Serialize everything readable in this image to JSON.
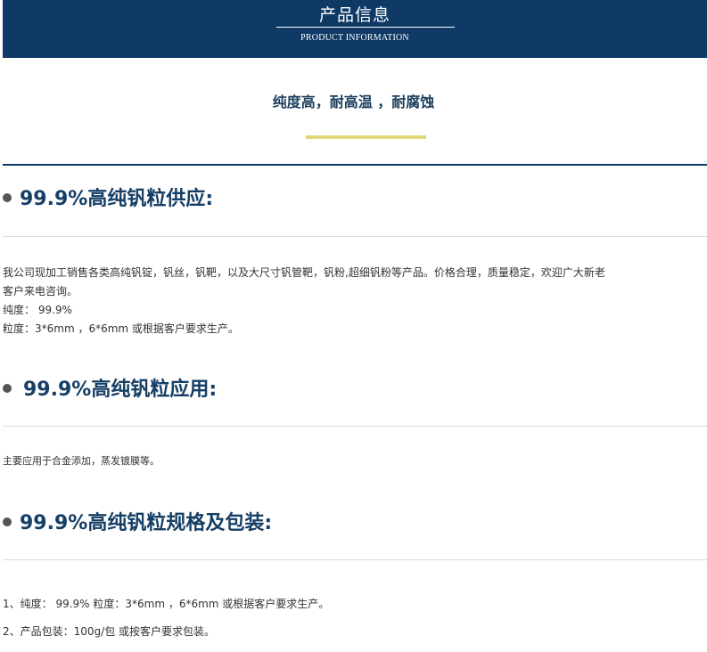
{
  "header": {
    "title": "产品信息",
    "subtitle": "PRODUCT INFORMATION"
  },
  "tagline": "纯度高，耐高温 ，耐腐蚀",
  "sections": [
    {
      "heading": "99.9%高纯钒粒供应:",
      "lines": [
        "我公司现加工销售各类高纯钒锭，钒丝，钒靶，以及大尺寸钒管靶，钒粉,超细钒粉等产品。价格合理，质量稳定，欢迎广大新老",
        "客户来电咨询。",
        "纯度： 99.9%",
        "粒度：3*6mm ，6*6mm 或根据客户要求生产。"
      ]
    },
    {
      "heading": "99.9%高纯钒粒应用:",
      "lines": [
        "主要应用于合金添加，蒸发镀膜等。"
      ]
    },
    {
      "heading": "99.9%高纯钒粒规格及包装:",
      "lines": [
        "1、纯度： 99.9% 粒度：3*6mm ，6*6mm 或根据客户要求生产。",
        "2、产品包装：100g/包 或按客户要求包装。"
      ]
    }
  ]
}
